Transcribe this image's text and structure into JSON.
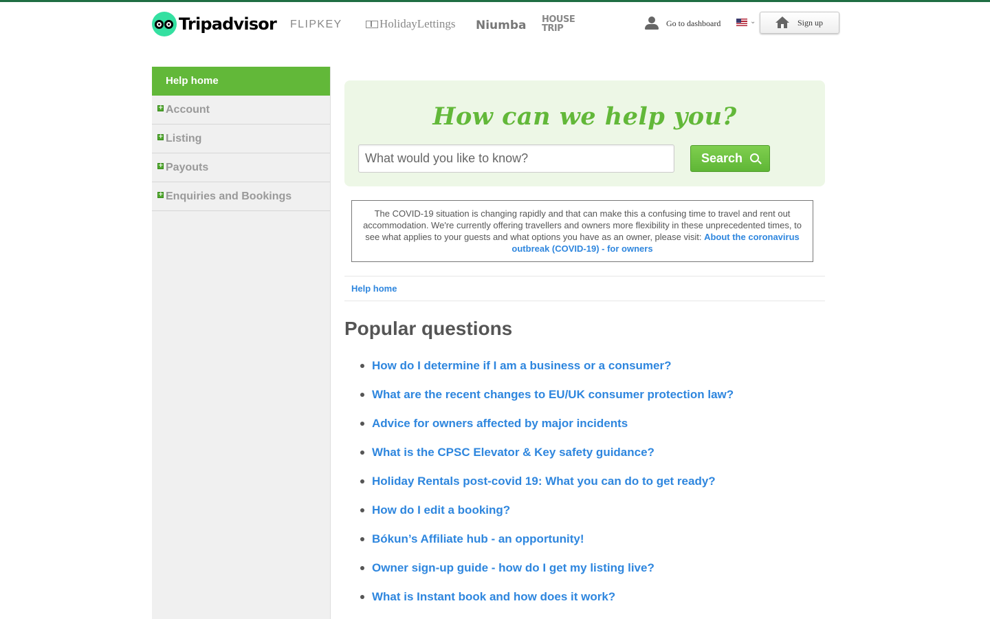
{
  "header": {
    "logo_text": "Tripadvisor",
    "brands": [
      "FLIPKEY",
      "HolidayLettings",
      "Niumba",
      "HOUSE",
      "TRIP"
    ],
    "dashboard_label": "Go to dashboard",
    "language_chevron": "⌄",
    "signup_label": "Sign up"
  },
  "sidebar": {
    "home_label": "Help home",
    "items": [
      {
        "label": "Account"
      },
      {
        "label": "Listing"
      },
      {
        "label": "Payouts"
      },
      {
        "label": "Enquiries and Bookings"
      }
    ],
    "expand_glyph": "+"
  },
  "hero": {
    "title": "How can we help you?",
    "search_placeholder": "What would you like to know?",
    "search_button": "Search"
  },
  "notice": {
    "text": "The COVID-19 situation is changing rapidly and that can make this a confusing time to travel and rent out accommodation. We're currently offering travellers and owners more flexibility in these unprecedented times, to see what applies to your guests and what options you have as an owner, please visit: ",
    "link": "About the coronavirus outbreak (COVID-19) - for owners"
  },
  "breadcrumb": {
    "home": "Help home"
  },
  "popular": {
    "title": "Popular questions",
    "questions": [
      "How do I determine if I am a business or a consumer?",
      "What are the recent changes to EU/UK consumer protection law?",
      "Advice for owners affected by major incidents",
      "What is the CPSC Elevator & Key safety guidance?",
      "Holiday Rentals post-covid 19: What you can do to get ready?",
      "How do I edit a booking?",
      "Bókun’s Affiliate hub - an opportunity!",
      "Owner sign-up guide - how do I get my listing live?",
      "What is Instant book and how does it work?"
    ]
  },
  "colors": {
    "accent_green": "#62b839",
    "link_blue": "#2e86de",
    "hero_bg": "#edf7e6",
    "topline": "#1f6e43"
  }
}
